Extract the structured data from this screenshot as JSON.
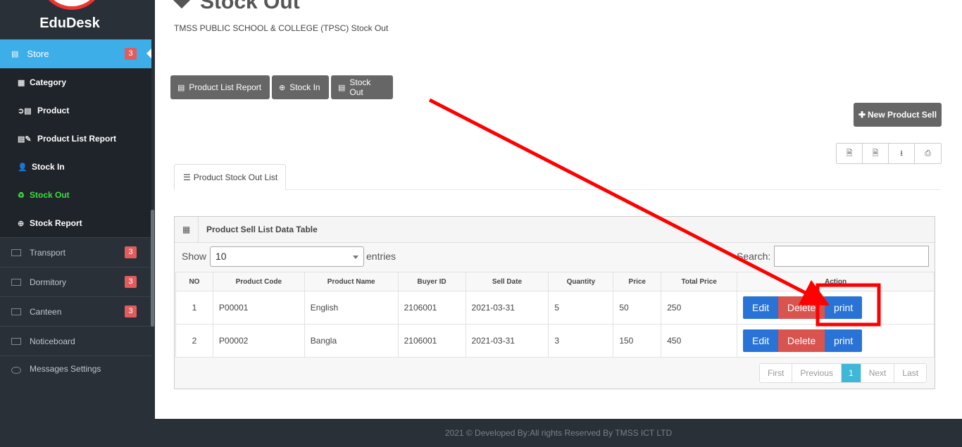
{
  "sidebar": {
    "brand": "EduDesk",
    "active": {
      "label": "Store",
      "badge": "3"
    },
    "sub_items": [
      {
        "icon": "th-icon",
        "label": "Category"
      },
      {
        "icon": "product-icon",
        "label": "Product"
      },
      {
        "icon": "book-edit-icon",
        "label": "Product List Report"
      },
      {
        "icon": "user-in-icon",
        "label": "Stock In"
      },
      {
        "icon": "recycle-icon",
        "label": "Stock Out"
      },
      {
        "icon": "plus-circle-icon",
        "label": "Stock Report"
      }
    ],
    "top_items": [
      {
        "label": "Transport",
        "badge": "3"
      },
      {
        "label": "Dormitory",
        "badge": "3"
      },
      {
        "label": "Canteen",
        "badge": "3"
      },
      {
        "label": "Noticeboard",
        "badge": ""
      },
      {
        "label": "Messages Settings",
        "badge": ""
      }
    ]
  },
  "page": {
    "title": "Stock Out",
    "subtitle": "TMSS PUBLIC SCHOOL & COLLEGE (TPSC) Stock Out"
  },
  "toolbar": {
    "product_list_report": "Product List Report",
    "stock_in": "Stock In",
    "stock_out": "Stock Out",
    "new_product_sell": "New Product Sell"
  },
  "tab": {
    "label": "Product Stock Out List"
  },
  "panel": {
    "title": "Product Sell List Data Table",
    "show_label": "Show",
    "page_size": "10",
    "entries_label": "entries",
    "search_label": "Search:"
  },
  "table": {
    "headers": [
      "NO",
      "Product Code",
      "Product Name",
      "Buyer ID",
      "Sell Date",
      "Quantity",
      "Price",
      "Total Price",
      "Action"
    ],
    "rows": [
      {
        "no": "1",
        "code": "P00001",
        "name": "English",
        "buyer": "2106001",
        "date": "2021-03-31",
        "qty": "5",
        "price": "50",
        "total": "250"
      },
      {
        "no": "2",
        "code": "P00002",
        "name": "Bangla",
        "buyer": "2106001",
        "date": "2021-03-31",
        "qty": "3",
        "price": "150",
        "total": "450"
      }
    ],
    "actions": {
      "edit": "Edit",
      "delete": "Delete",
      "print": "print"
    }
  },
  "pagination": {
    "first": "First",
    "previous": "Previous",
    "current": "1",
    "next": "Next",
    "last": "Last"
  },
  "footer": {
    "text": "2021 © Developed By:All rights Reserved By TMSS ICT LTD"
  },
  "colors": {
    "accent": "#3eaee8",
    "annotation": "#ff0000",
    "danger": "#d9534f",
    "primary": "#2973d6"
  }
}
